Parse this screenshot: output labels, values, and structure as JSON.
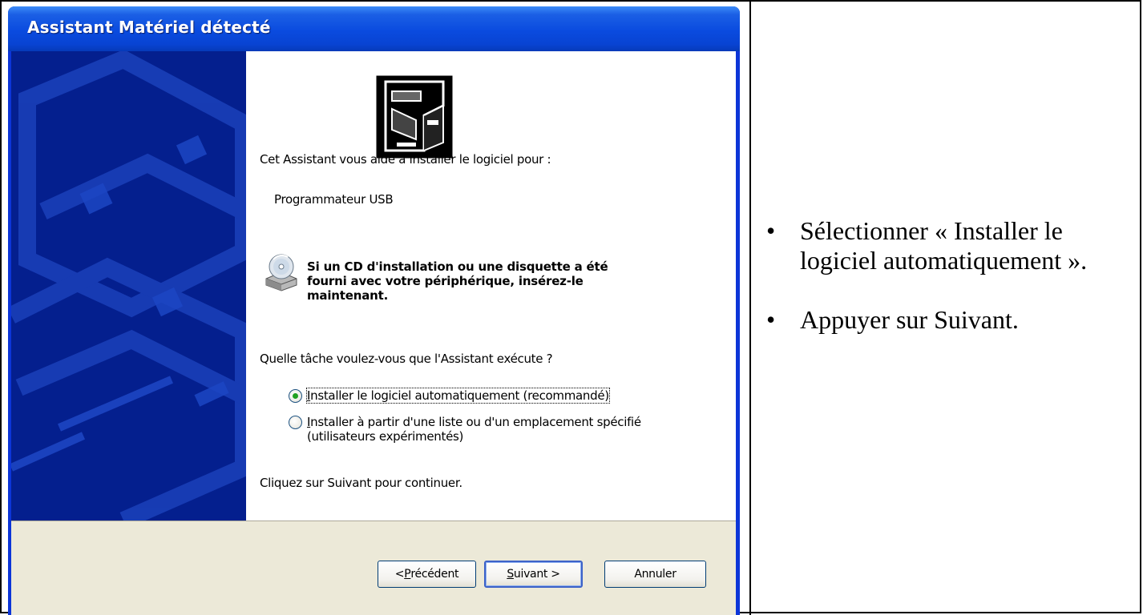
{
  "window": {
    "title": "Assistant Matériel détecté"
  },
  "wizard": {
    "intro": "Cet Assistant vous aide à installer le logiciel pour :",
    "device_name": "Programmateur USB",
    "cd_message_lines": [
      "Si un CD d'installation ou une disquette a été",
      "fourni avec votre périphérique, insérez-le",
      "maintenant."
    ],
    "question": "Quelle tâche voulez-vous que l'Assistant exécute ?",
    "options": [
      {
        "key_letter": "I",
        "rest": "nstaller le logiciel automatiquement (recommandé)",
        "selected": true
      },
      {
        "key_letter": "I",
        "rest_line1": "nstaller à partir d'une liste ou d'un emplacement spécifié",
        "line2": "(utilisateurs expérimentés)",
        "selected": false
      }
    ],
    "continue_text": "Cliquez sur Suivant pour continuer."
  },
  "buttons": {
    "back": {
      "prefix": "< ",
      "key_letter": "P",
      "rest": "récédent"
    },
    "next": {
      "key_letter": "S",
      "rest": "uivant >"
    },
    "cancel": "Annuler"
  },
  "instructions": [
    "Sélectionner « Installer le logiciel automatiquement ».",
    "Appuyer sur Suivant."
  ],
  "colors": {
    "titlebar": "#0a4bdf",
    "left_panel": "#041f8e",
    "footer": "#ece9d8",
    "radio_dot": "#21a121"
  }
}
